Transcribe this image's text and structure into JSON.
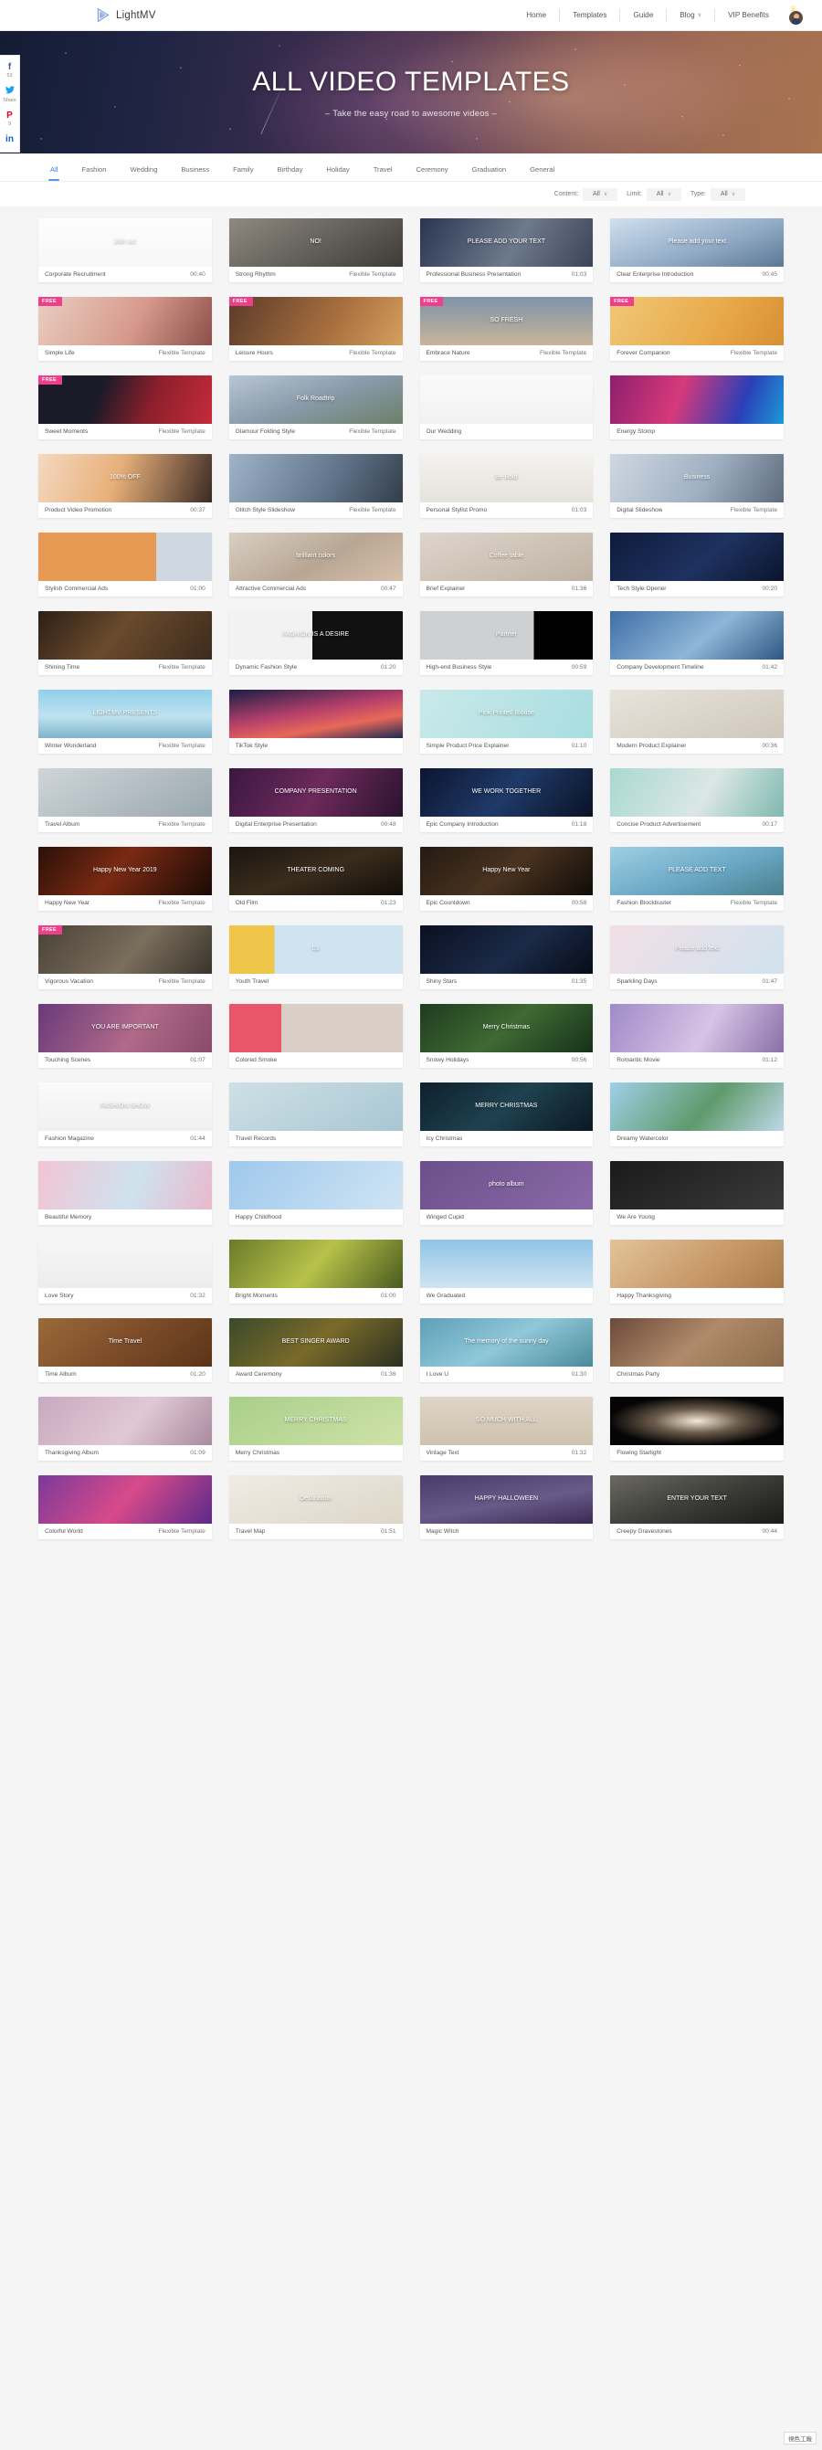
{
  "brand": {
    "name": "LightMV",
    "logo_icon": "play-triangle-logo"
  },
  "nav": {
    "items": [
      {
        "label": "Home"
      },
      {
        "label": "Templates"
      },
      {
        "label": "Guide"
      },
      {
        "label": "Blog",
        "caret": "∨"
      },
      {
        "label": "VIP Benefits"
      }
    ],
    "avatar_icon": "user-avatar",
    "crown_icon": "crown-icon"
  },
  "hero": {
    "title": "ALL VIDEO TEMPLATES",
    "subtitle": "– Take the easy road to awesome videos –"
  },
  "social": [
    {
      "network": "facebook",
      "glyph": "f",
      "count": "53",
      "icon": "facebook-icon"
    },
    {
      "network": "twitter",
      "glyph": "🐦",
      "count": "Share",
      "icon": "twitter-icon"
    },
    {
      "network": "pinterest",
      "glyph": "P",
      "count": "9",
      "icon": "pinterest-icon"
    },
    {
      "network": "linkedin",
      "glyph": "in",
      "count": "",
      "icon": "linkedin-icon"
    }
  ],
  "tabs": [
    {
      "label": "All",
      "active": true
    },
    {
      "label": "Fashion",
      "active": false
    },
    {
      "label": "Wedding",
      "active": false
    },
    {
      "label": "Business",
      "active": false
    },
    {
      "label": "Family",
      "active": false
    },
    {
      "label": "Birthday",
      "active": false
    },
    {
      "label": "Holiday",
      "active": false
    },
    {
      "label": "Travel",
      "active": false
    },
    {
      "label": "Ceremony",
      "active": false
    },
    {
      "label": "Graduation",
      "active": false
    },
    {
      "label": "General",
      "active": false
    }
  ],
  "filters": [
    {
      "label": "Content:",
      "value": "All"
    },
    {
      "label": "Limit:",
      "value": "All"
    },
    {
      "label": "Type:",
      "value": "All"
    }
  ],
  "watermark": "視色工廠",
  "accent_colors": {
    "brand_blue": "#4a9be8",
    "free_badge": "#ef3e8a",
    "tab_active": "#2f7fe0"
  },
  "templates": [
    {
      "name": "Corporate Recruitment",
      "duration": "00:40",
      "free": false,
      "overlay": "Join us!",
      "style": "t-join"
    },
    {
      "name": "Strong Rhythm",
      "duration": "Flexible Template",
      "free": false,
      "overlay": "NO!",
      "style": "t-rhythm"
    },
    {
      "name": "Professional Business Presentation",
      "duration": "01:03",
      "free": false,
      "overlay": "PLEASE ADD YOUR TEXT",
      "style": "t-bizpres"
    },
    {
      "name": "Clear Enterprise Introduction",
      "duration": "00:45",
      "free": false,
      "overlay": "Please add your text",
      "style": "t-enterprise"
    },
    {
      "name": "Simple Life",
      "duration": "Flexible Template",
      "free": true,
      "overlay": "",
      "style": "t-simplelife"
    },
    {
      "name": "Leisure Hours",
      "duration": "Flexible Template",
      "free": true,
      "overlay": "",
      "style": "t-leisure"
    },
    {
      "name": "Embrace Nature",
      "duration": "Flexible Template",
      "free": true,
      "overlay": "SO FRESH",
      "style": "t-nature"
    },
    {
      "name": "Forever Companion",
      "duration": "Flexible Template",
      "free": true,
      "overlay": "",
      "style": "t-companion"
    },
    {
      "name": "Sweet Moments",
      "duration": "Flexible Template",
      "free": true,
      "overlay": "",
      "style": "t-sweet"
    },
    {
      "name": "Glamour Folding Style",
      "duration": "Flexible Template",
      "free": false,
      "overlay": "Folk Roadtrip",
      "style": "t-glamour"
    },
    {
      "name": "Our Wedding",
      "duration": "",
      "free": false,
      "overlay": "",
      "style": "t-wedding"
    },
    {
      "name": "Energy Stomp",
      "duration": "",
      "free": false,
      "overlay": "",
      "style": "t-energy"
    },
    {
      "name": "Product Video Promotion",
      "duration": "00:37",
      "free": false,
      "overlay": "100% OFF",
      "style": "t-promo"
    },
    {
      "name": "Glitch Style Slideshow",
      "duration": "Flexible Template",
      "free": false,
      "overlay": "",
      "style": "t-glitch"
    },
    {
      "name": "Personal Stylist Promo",
      "duration": "01:03",
      "free": false,
      "overlay": "Be Bold",
      "style": "t-stylist"
    },
    {
      "name": "Digital Slideshow",
      "duration": "Flexible Template",
      "free": false,
      "overlay": "Business",
      "style": "t-digital"
    },
    {
      "name": "Stylish Commercial Ads",
      "duration": "01:00",
      "free": false,
      "overlay": "",
      "style": "t-stylishads"
    },
    {
      "name": "Attractive Commercial Ads",
      "duration": "00:47",
      "free": false,
      "overlay": "brilliant colors",
      "style": "t-attractads"
    },
    {
      "name": "Brief Explainer",
      "duration": "01:36",
      "free": false,
      "overlay": "Coffee table",
      "style": "t-brief"
    },
    {
      "name": "Tech Style Opener",
      "duration": "00:20",
      "free": false,
      "overlay": "",
      "style": "t-tech"
    },
    {
      "name": "Shining Time",
      "duration": "Flexible Template",
      "free": false,
      "overlay": "",
      "style": "t-shining"
    },
    {
      "name": "Dynamic Fashion Style",
      "duration": "01:20",
      "free": false,
      "overlay": "FASHION IS A DESIRE",
      "style": "t-dynfashion"
    },
    {
      "name": "High-end Business Style",
      "duration": "00:59",
      "free": false,
      "overlay": "Partner",
      "style": "t-highend"
    },
    {
      "name": "Company Development Timeline",
      "duration": "01:42",
      "free": false,
      "overlay": "",
      "style": "t-timeline"
    },
    {
      "name": "Winter Wonderland",
      "duration": "Flexible Template",
      "free": false,
      "overlay": "LIGHTMV PRESENTS",
      "style": "t-winter"
    },
    {
      "name": "TikTok Style",
      "duration": "",
      "free": false,
      "overlay": "",
      "style": "t-tiktok"
    },
    {
      "name": "Simple Product Price Explainer",
      "duration": "01:10",
      "free": false,
      "overlay": "Pink Printed Blouse",
      "style": "t-pinkblouse"
    },
    {
      "name": "Modern Product Explainer",
      "duration": "00:36",
      "free": false,
      "overlay": "",
      "style": "t-modernprod"
    },
    {
      "name": "Travel Album",
      "duration": "Flexible Template",
      "free": false,
      "overlay": "",
      "style": "t-travelalbum"
    },
    {
      "name": "Digital Enterprise Presentation",
      "duration": "00:48",
      "free": false,
      "overlay": "COMPANY PRESENTATION",
      "style": "t-digent"
    },
    {
      "name": "Epic Company Introduction",
      "duration": "01:18",
      "free": false,
      "overlay": "WE WORK TOGETHER",
      "style": "t-epicco"
    },
    {
      "name": "Concise Product Advertisement",
      "duration": "00:17",
      "free": false,
      "overlay": "",
      "style": "t-concise"
    },
    {
      "name": "Happy New Year",
      "duration": "Flexible Template",
      "free": false,
      "overlay": "Happy New Year 2019",
      "style": "t-hny"
    },
    {
      "name": "Old Film",
      "duration": "01:23",
      "free": false,
      "overlay": "THEATER COMING",
      "style": "t-oldfilm"
    },
    {
      "name": "Epic Countdown",
      "duration": "00:58",
      "free": false,
      "overlay": "Happy New Year",
      "style": "t-countdown"
    },
    {
      "name": "Fashion Blockbuster",
      "duration": "Flexible Template",
      "free": false,
      "overlay": "PLEASE ADD TEXT",
      "style": "t-blockbuster"
    },
    {
      "name": "Vigorous Vacation",
      "duration": "Flexible Template",
      "free": true,
      "overlay": "",
      "style": "t-vigorous"
    },
    {
      "name": "Youth Travel",
      "duration": "",
      "free": false,
      "overlay": "03",
      "style": "t-youth"
    },
    {
      "name": "Shiny Stars",
      "duration": "01:35",
      "free": false,
      "overlay": "",
      "style": "t-shinystars"
    },
    {
      "name": "Sparkling Days",
      "duration": "01:47",
      "free": false,
      "overlay": "Please add text",
      "style": "t-sparkling"
    },
    {
      "name": "Touching Scenes",
      "duration": "01:07",
      "free": false,
      "overlay": "YOU ARE IMPORTANT",
      "style": "t-touching"
    },
    {
      "name": "Colored Smoke",
      "duration": "",
      "free": false,
      "overlay": "",
      "style": "t-smoke"
    },
    {
      "name": "Snowy Holidays",
      "duration": "00:56",
      "free": false,
      "overlay": "Merry Christmas",
      "style": "t-snowy"
    },
    {
      "name": "Romantic Movie",
      "duration": "01:12",
      "free": false,
      "overlay": "",
      "style": "t-romantic"
    },
    {
      "name": "Fashion Magazine",
      "duration": "01:44",
      "free": false,
      "overlay": "FASHION SHOW",
      "style": "t-magazine"
    },
    {
      "name": "Travel Records",
      "duration": "",
      "free": false,
      "overlay": "",
      "style": "t-records"
    },
    {
      "name": "Icy Christmas",
      "duration": "",
      "free": false,
      "overlay": "MERRY CHRISTMAS",
      "style": "t-icy"
    },
    {
      "name": "Dreamy Watercolor",
      "duration": "",
      "free": false,
      "overlay": "",
      "style": "t-watercolor"
    },
    {
      "name": "Beautiful Memory",
      "duration": "",
      "free": false,
      "overlay": "",
      "style": "t-beautiful"
    },
    {
      "name": "Happy Childhood",
      "duration": "",
      "free": false,
      "overlay": "",
      "style": "t-childhood"
    },
    {
      "name": "Winged Cupid",
      "duration": "",
      "free": false,
      "overlay": "photo album",
      "style": "t-cupid"
    },
    {
      "name": "We Are Young",
      "duration": "",
      "free": false,
      "overlay": "",
      "style": "t-young"
    },
    {
      "name": "Love Story",
      "duration": "01:32",
      "free": false,
      "overlay": "",
      "style": "t-lovestory"
    },
    {
      "name": "Bright Moments",
      "duration": "01:00",
      "free": false,
      "overlay": "",
      "style": "t-bright"
    },
    {
      "name": "We Graduated",
      "duration": "",
      "free": false,
      "overlay": "",
      "style": "t-graduated"
    },
    {
      "name": "Happy Thanksgiving",
      "duration": "",
      "free": false,
      "overlay": "",
      "style": "t-thanksgiving"
    },
    {
      "name": "Time Album",
      "duration": "01:20",
      "free": false,
      "overlay": "Time Travel",
      "style": "t-timealbum"
    },
    {
      "name": "Award Ceremony",
      "duration": "01:36",
      "free": false,
      "overlay": "BEST SINGER AWARD",
      "style": "t-award"
    },
    {
      "name": "I Love U",
      "duration": "01:30",
      "free": false,
      "overlay": "The memory of the sunny day",
      "style": "t-iloveu"
    },
    {
      "name": "Christmas Party",
      "duration": "",
      "free": false,
      "overlay": "",
      "style": "t-xmasparty"
    },
    {
      "name": "Thanksgiving Album",
      "duration": "01:09",
      "free": false,
      "overlay": "",
      "style": "t-thanksalbum"
    },
    {
      "name": "Merry Christmas",
      "duration": "",
      "free": false,
      "overlay": "MERRY CHRISTMAS",
      "style": "t-merryxmas"
    },
    {
      "name": "Vintage Text",
      "duration": "01:32",
      "free": false,
      "overlay": "SO MUCH WITH ALL",
      "style": "t-vintage"
    },
    {
      "name": "Flowing Starlight",
      "duration": "",
      "free": false,
      "overlay": "",
      "style": "t-starlight"
    },
    {
      "name": "Colorful World",
      "duration": "Flexible Template",
      "free": false,
      "overlay": "",
      "style": "t-colorful"
    },
    {
      "name": "Travel Map",
      "duration": "01:51",
      "free": false,
      "overlay": "Destination",
      "style": "t-travelmap"
    },
    {
      "name": "Magic Witch",
      "duration": "",
      "free": false,
      "overlay": "HAPPY HALLOWEEN",
      "style": "t-witch"
    },
    {
      "name": "Creepy Gravestones",
      "duration": "00:44",
      "free": false,
      "overlay": "ENTER YOUR TEXT",
      "style": "t-gravestones"
    }
  ]
}
